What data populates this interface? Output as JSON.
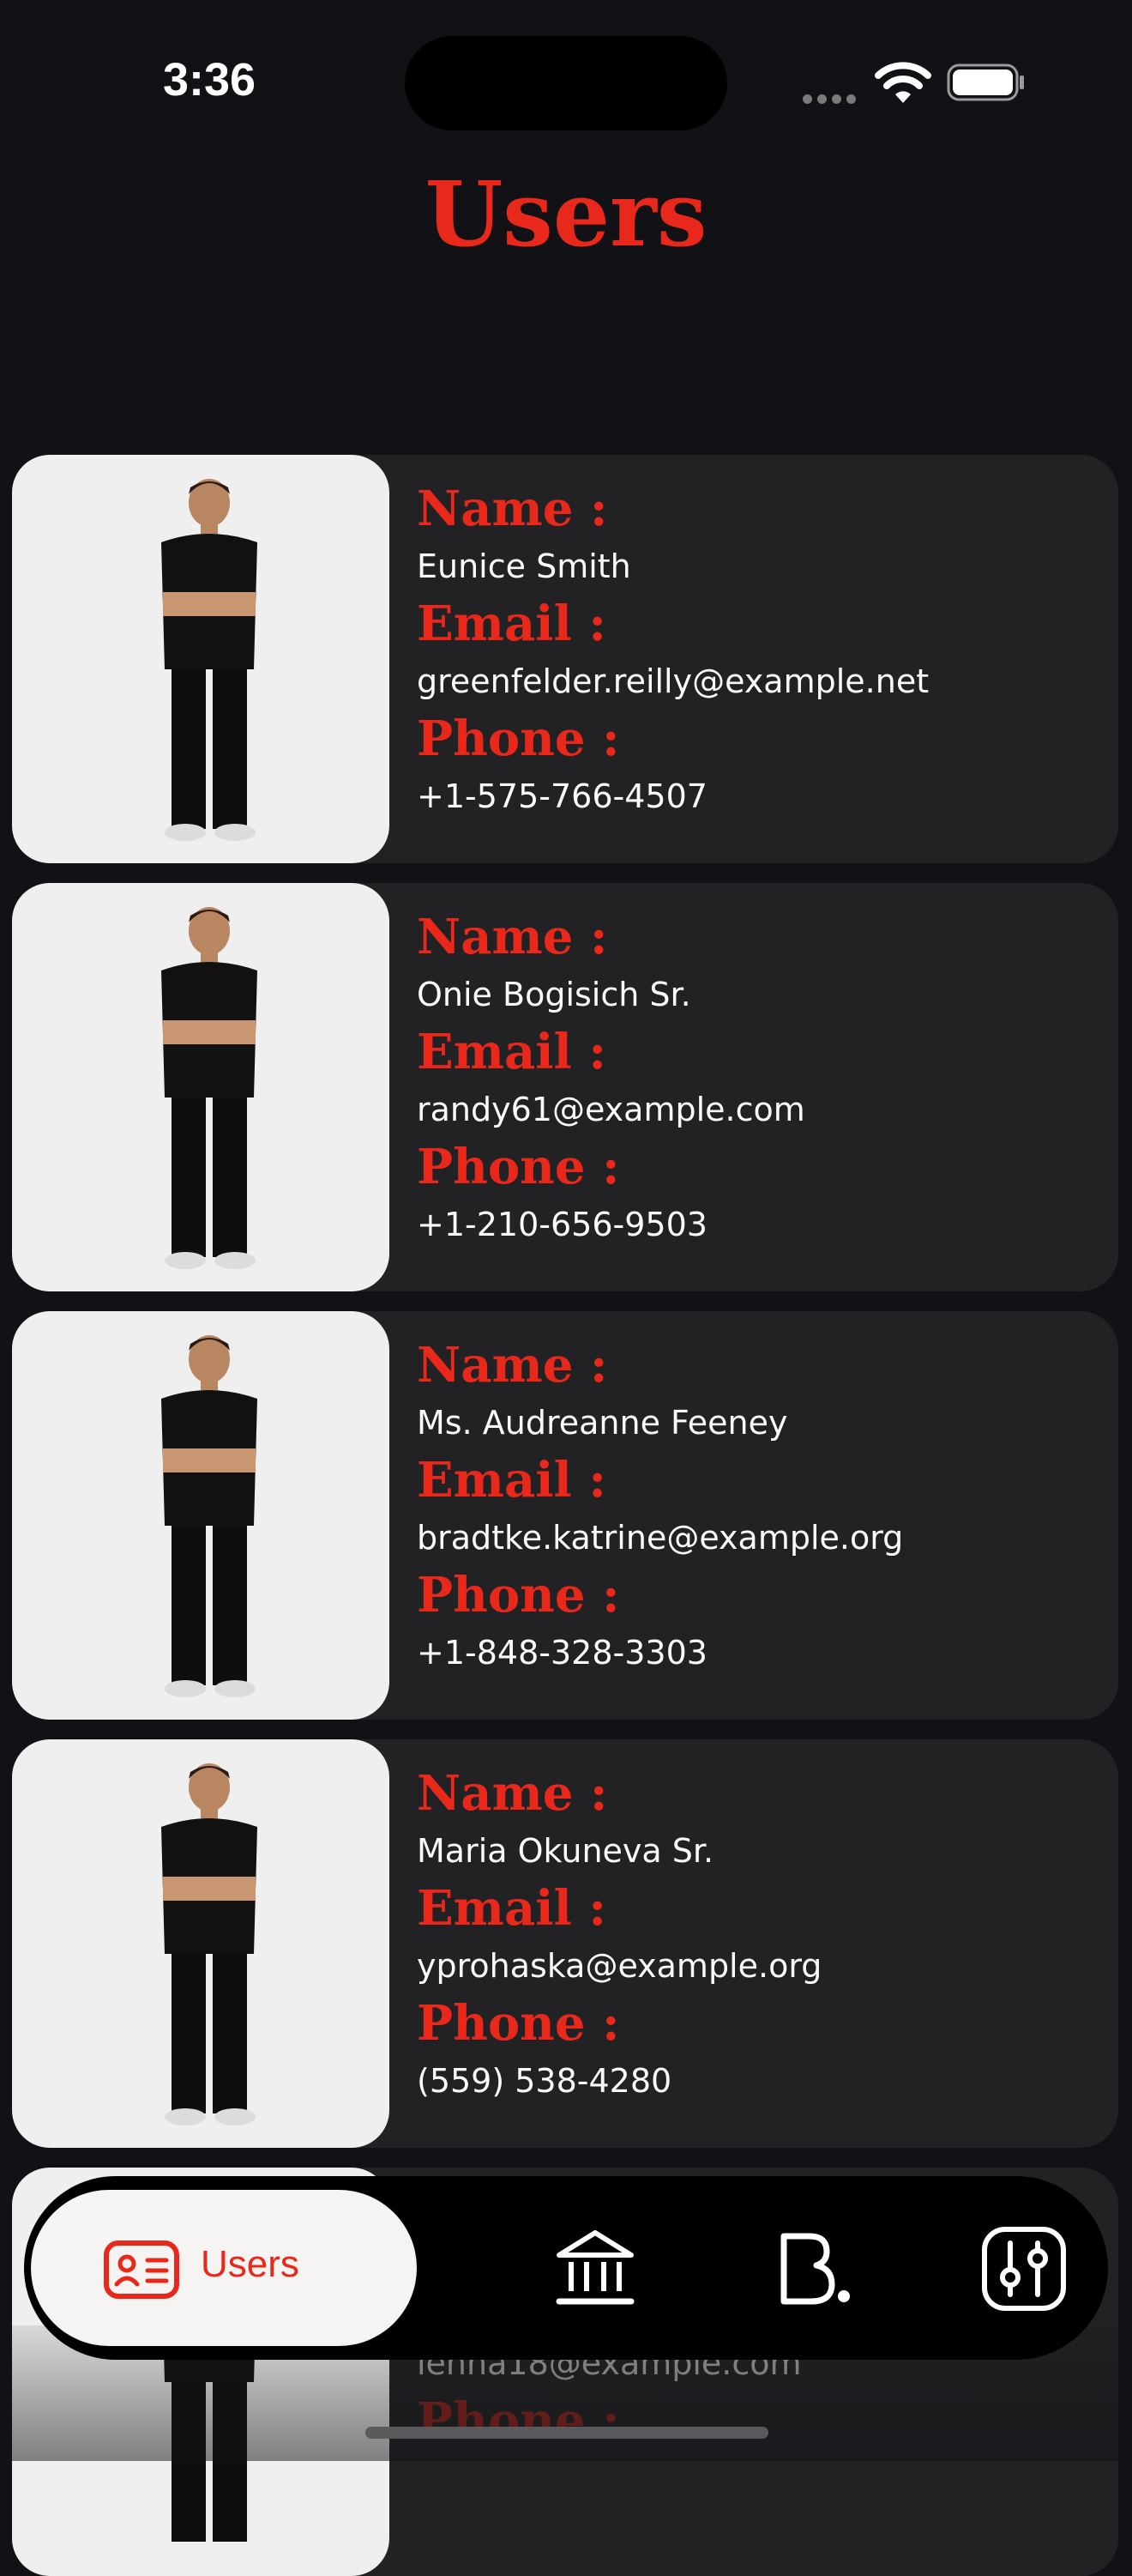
{
  "status": {
    "time": "3:36"
  },
  "page": {
    "title": "Users"
  },
  "labels": {
    "name": "Name :",
    "email": "Email :",
    "phone": "Phone :"
  },
  "users": [
    {
      "name": "Eunice Smith",
      "email": "greenfelder.reilly@example.net",
      "phone": "+1-575-766-4507"
    },
    {
      "name": "Onie Bogisich Sr.",
      "email": "randy61@example.com",
      "phone": "+1-210-656-9503"
    },
    {
      "name": "Ms. Audreanne Feeney",
      "email": "bradtke.katrine@example.org",
      "phone": "+1-848-328-3303"
    },
    {
      "name": "Maria Okuneva Sr.",
      "email": "yprohaska@example.org",
      "phone": "(559) 538-4280"
    },
    {
      "name": "",
      "email": "lenna18@example.com",
      "phone": ""
    }
  ],
  "nav": {
    "items": [
      {
        "label": "Users",
        "icon": "id-card-icon",
        "active": true
      },
      {
        "label": "",
        "icon": "bank-icon",
        "active": false
      },
      {
        "label": "",
        "icon": "behance-icon",
        "active": false
      },
      {
        "label": "",
        "icon": "settings-sliders-icon",
        "active": false
      }
    ]
  },
  "colors": {
    "accent": "#e8281b",
    "background": "#121116",
    "card": "#222224",
    "photo_bg": "#efefef"
  }
}
